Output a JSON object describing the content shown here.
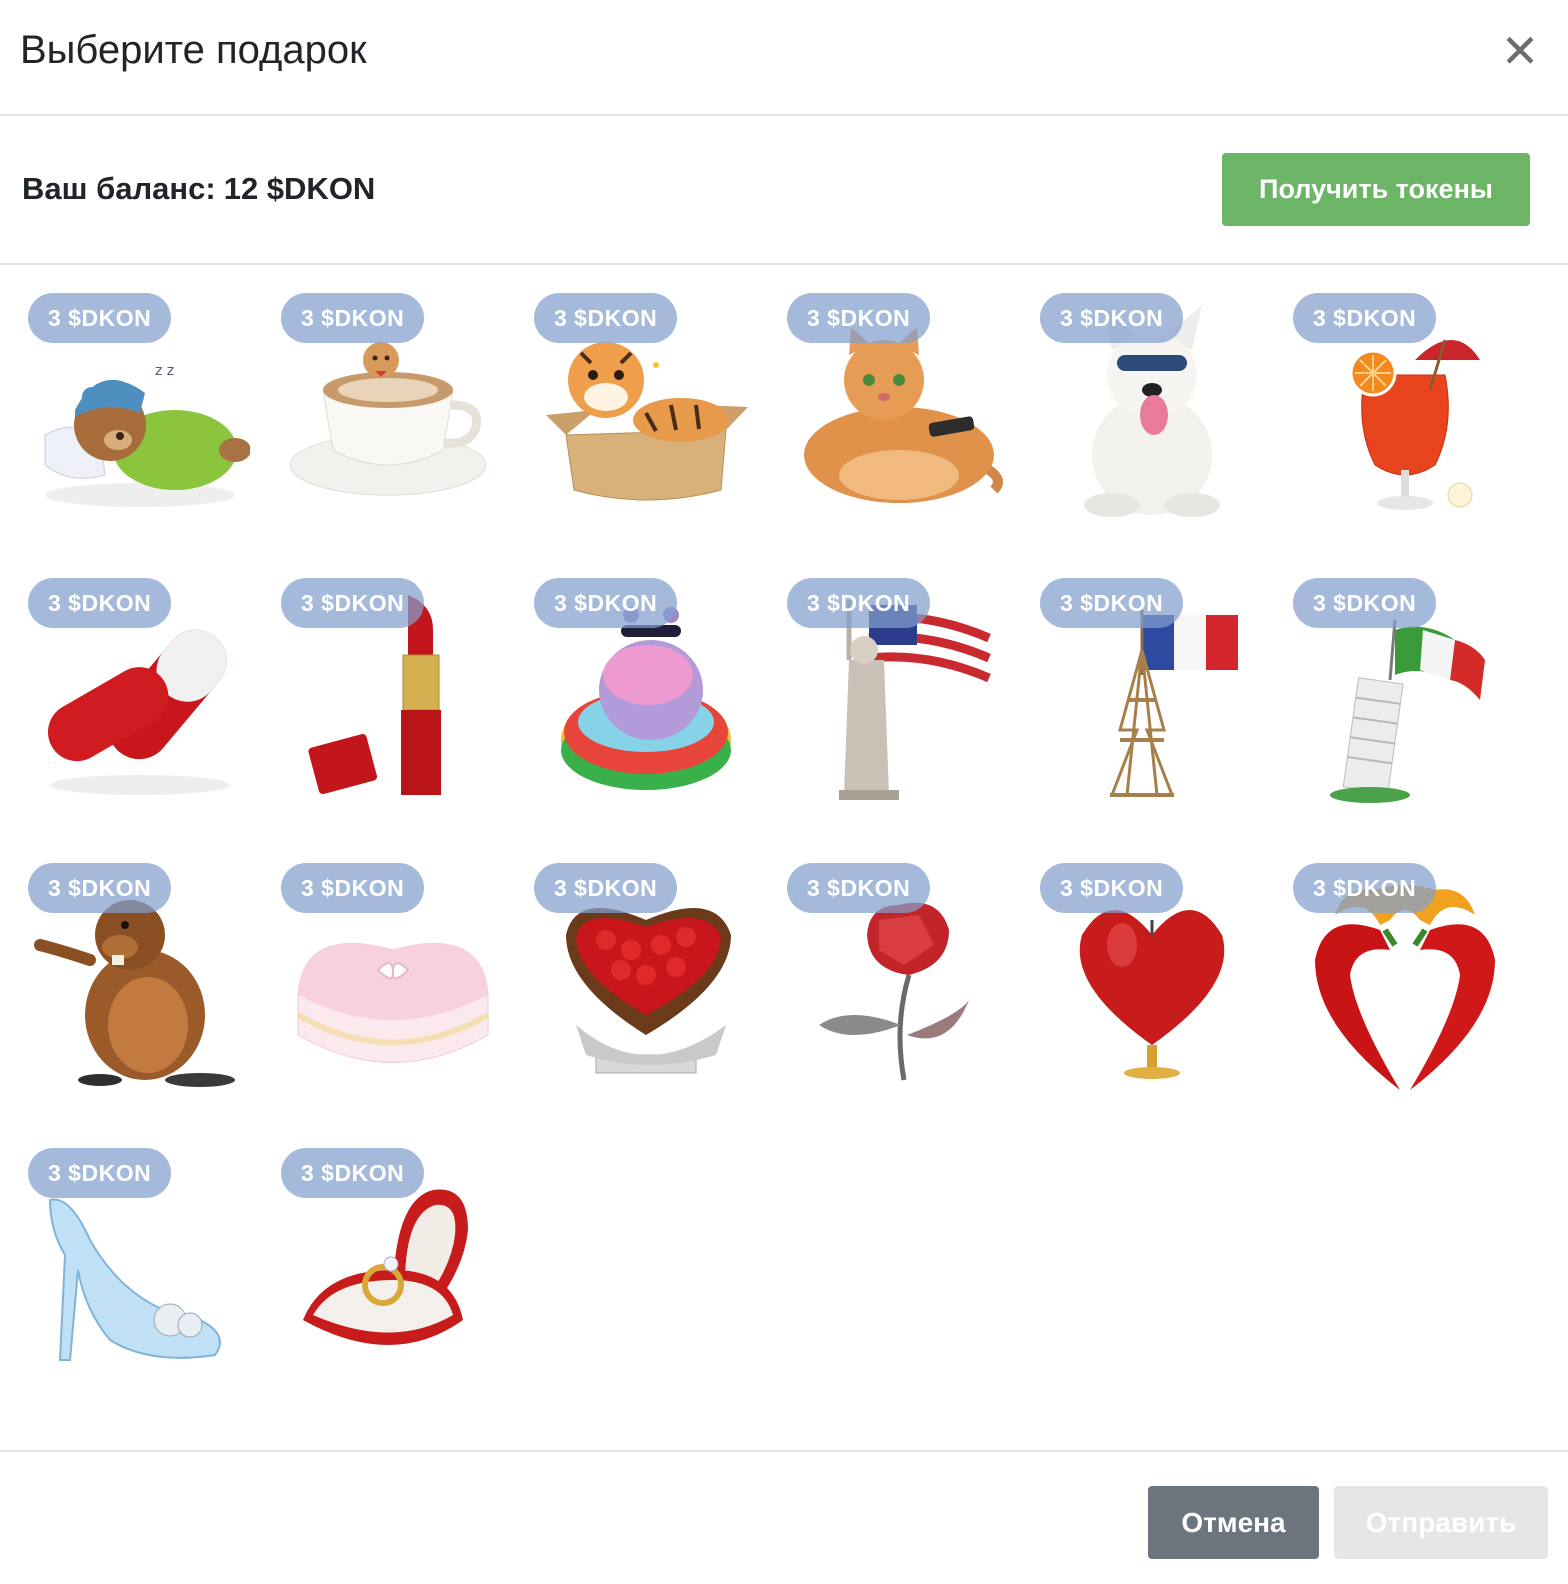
{
  "modal": {
    "title": "Выберите подарок",
    "close_icon": "close-icon"
  },
  "balance": {
    "label": "Ваш баланс:",
    "value": "12 $DKON",
    "get_tokens_label": "Получить токены",
    "get_tokens_color": "#6cb566"
  },
  "gifts": [
    {
      "price": "3 $DKON",
      "icon": "sleeping-bear"
    },
    {
      "price": "3 $DKON",
      "icon": "cappuccino-cup"
    },
    {
      "price": "3 $DKON",
      "icon": "tiger-in-box"
    },
    {
      "price": "3 $DKON",
      "icon": "fat-cat-with-remote"
    },
    {
      "price": "3 $DKON",
      "icon": "husky-puppy"
    },
    {
      "price": "3 $DKON",
      "icon": "tropical-cocktail"
    },
    {
      "price": "3 $DKON",
      "icon": "red-pills"
    },
    {
      "price": "3 $DKON",
      "icon": "red-lipstick"
    },
    {
      "price": "3 $DKON",
      "icon": "hippo-in-pool"
    },
    {
      "price": "3 $DKON",
      "icon": "statue-of-liberty-usa-flag"
    },
    {
      "price": "3 $DKON",
      "icon": "eiffel-tower-france-flag"
    },
    {
      "price": "3 $DKON",
      "icon": "pisa-tower-italy-flag"
    },
    {
      "price": "3 $DKON",
      "icon": "beaver"
    },
    {
      "price": "3 $DKON",
      "icon": "pink-heart-cake"
    },
    {
      "price": "3 $DKON",
      "icon": "cherry-heart-pie"
    },
    {
      "price": "3 $DKON",
      "icon": "crystal-rose"
    },
    {
      "price": "3 $DKON",
      "icon": "heart-candle"
    },
    {
      "price": "3 $DKON",
      "icon": "chili-pepper-heart"
    },
    {
      "price": "3 $DKON",
      "icon": "glass-slipper"
    },
    {
      "price": "3 $DKON",
      "icon": "ring-in-heart-box"
    }
  ],
  "footer": {
    "cancel_label": "Отмена",
    "send_label": "Отправить",
    "cancel_color": "#6c757d",
    "send_color": "#e6e6e6"
  }
}
